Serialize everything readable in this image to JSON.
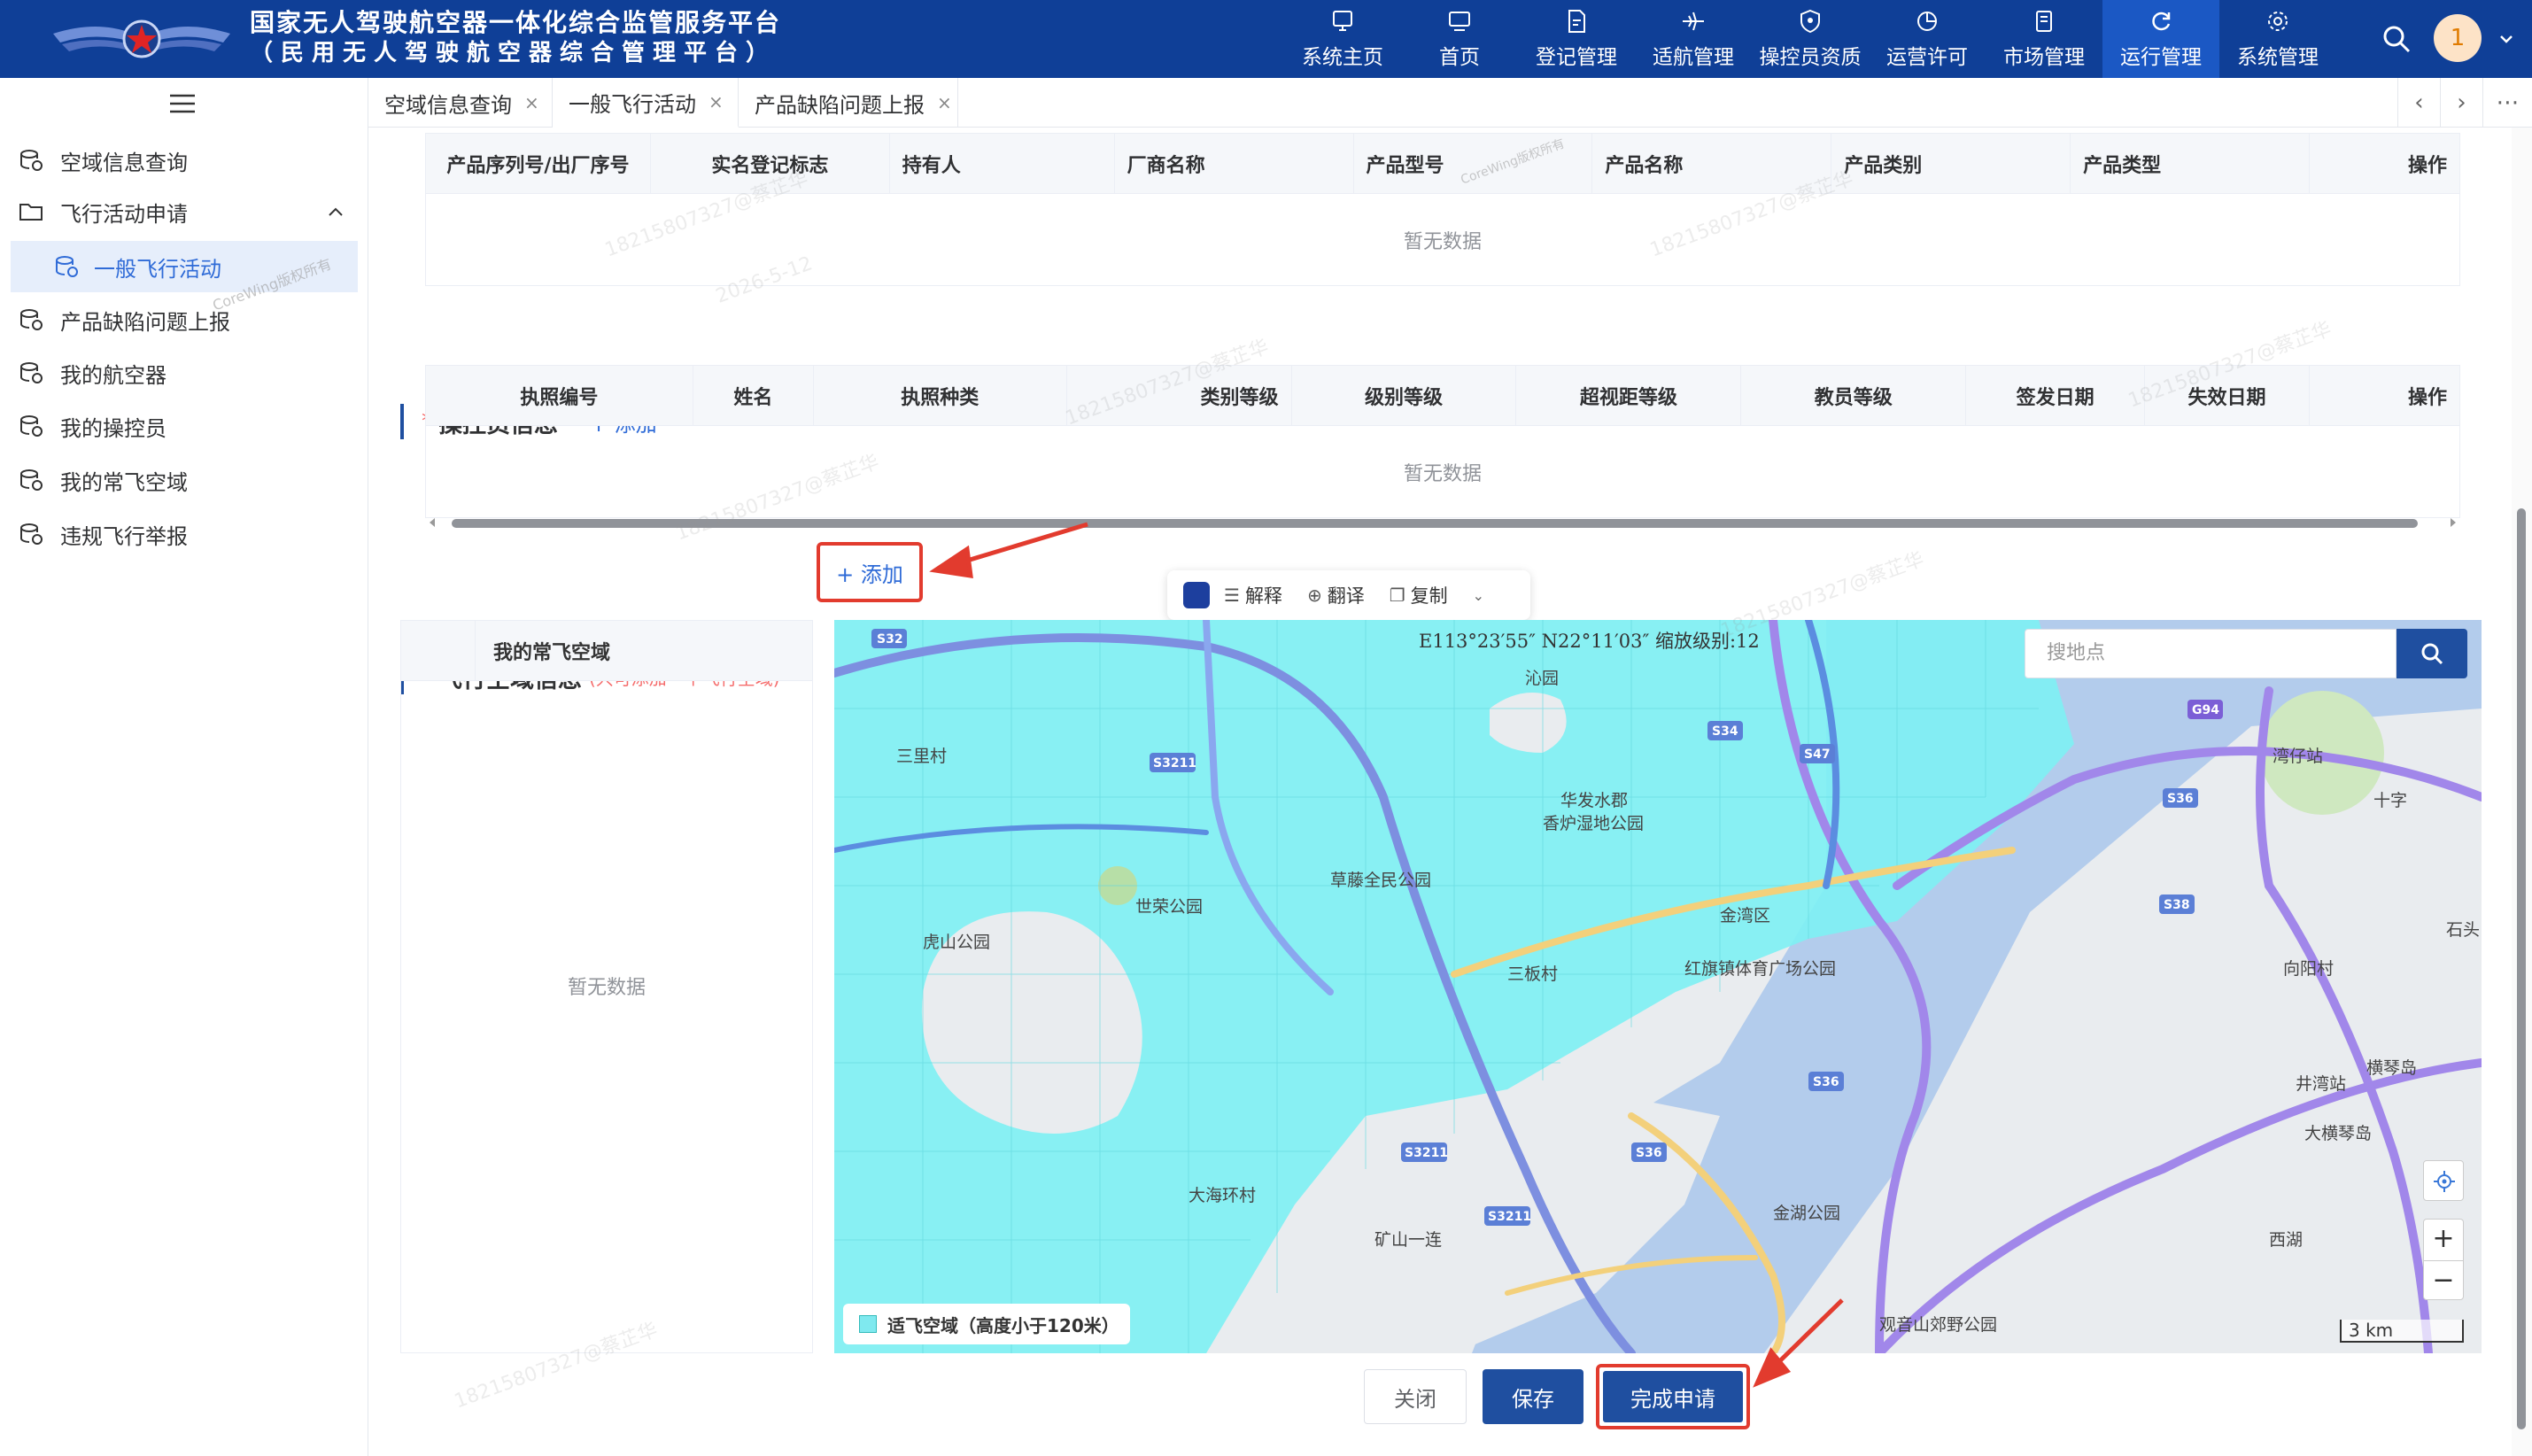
{
  "header": {
    "title_line1": "国家无人驾驶航空器一体化综合监管服务平台",
    "title_line2": "（民用无人驾驶航空器综合管理平台）",
    "nav": [
      {
        "label": "系统主页",
        "icon": "monitor-icon"
      },
      {
        "label": "首页",
        "icon": "screen-icon"
      },
      {
        "label": "登记管理",
        "icon": "doc-edit-icon"
      },
      {
        "label": "适航管理",
        "icon": "airplane-icon"
      },
      {
        "label": "操控员资质",
        "icon": "shield-icon"
      },
      {
        "label": "运营许可",
        "icon": "chart-icon"
      },
      {
        "label": "市场管理",
        "icon": "doc-icon"
      },
      {
        "label": "运行管理",
        "icon": "refresh-icon"
      },
      {
        "label": "系统管理",
        "icon": "settings-icon"
      }
    ],
    "active_nav": "运行管理",
    "avatar_text": "1"
  },
  "sidebar": {
    "items": [
      {
        "label": "空域信息查询"
      },
      {
        "label": "飞行活动申请"
      },
      {
        "label": "一般飞行活动"
      },
      {
        "label": "产品缺陷问题上报"
      },
      {
        "label": "我的航空器"
      },
      {
        "label": "我的操控员"
      },
      {
        "label": "我的常飞空域"
      },
      {
        "label": "违规飞行举报"
      }
    ]
  },
  "tabs": [
    {
      "label": "空域信息查询"
    },
    {
      "label": "一般飞行活动"
    },
    {
      "label": "产品缺陷问题上报"
    }
  ],
  "aircraft_table": {
    "columns": [
      "产品序列号/出厂序号",
      "实名登记标志",
      "持有人",
      "厂商名称",
      "产品型号",
      "产品名称",
      "产品类别",
      "产品类型",
      "操作"
    ],
    "empty_text": "暂无数据"
  },
  "operator_section": {
    "title": "操控员信息",
    "add_label": "+ 添加"
  },
  "operator_table": {
    "columns": [
      "执照编号",
      "姓名",
      "执照种类",
      "类别等级",
      "级别等级",
      "超视距等级",
      "教员等级",
      "签发日期",
      "失效日期",
      "操作"
    ],
    "empty_text": "暂无数据"
  },
  "airspace_section": {
    "title": "飞行空域信息",
    "hint": "(只可添加一个飞行空域)",
    "add_label": "+ 添加"
  },
  "selection_toolbar": {
    "explain": "解释",
    "translate": "翻译",
    "copy": "复制"
  },
  "favorite_airspace": {
    "header": "我的常飞空域",
    "empty_text": "暂无数据"
  },
  "map": {
    "coords": "E113°23′55″   N22°11′03″   缩放级别:12",
    "search_placeholder": "搜地点",
    "legend": "适飞空域（高度小于120米）",
    "scale": "3 km",
    "labels": [
      "三里村",
      "虎山公园",
      "世荣公园",
      "草藤全民公园",
      "华发水郡",
      "香炉湿地公园",
      "三板村",
      "红旗镇体育广场公园",
      "金湾区",
      "大海环村",
      "矿山一连",
      "金湖公园",
      "观音山郊野公园",
      "湾仔站",
      "十字",
      "向阳村",
      "石头",
      "井湾站",
      "大横琴岛",
      "横琴岛",
      "西湖",
      "沁园"
    ],
    "roads": [
      "S32",
      "S3211",
      "S34",
      "S47",
      "G94",
      "S36",
      "S38",
      "S36",
      "S3211",
      "S3211",
      "S36"
    ]
  },
  "buttons": {
    "close": "关闭",
    "save": "保存",
    "complete": "完成申请"
  },
  "watermark": {
    "line1": "18215807327@蔡芷华",
    "line2": "2026-5-12",
    "brand": "CoreWing版权所有"
  }
}
